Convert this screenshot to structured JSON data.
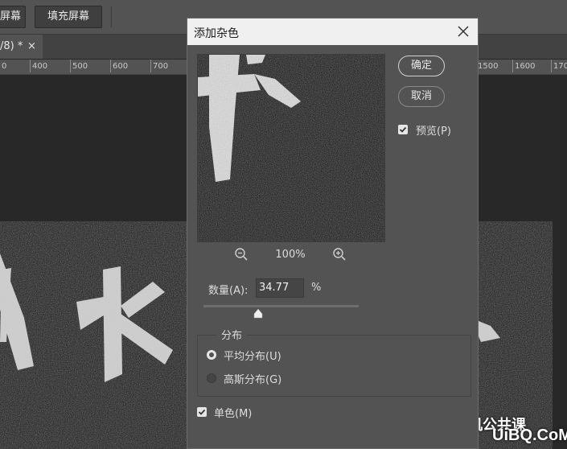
{
  "photoshop": {
    "toolbar": {
      "button_fit_screen_partial": "屏幕",
      "button_fill_screen": "填充屏幕"
    },
    "doc_tab": {
      "title": "/8) *",
      "close": "×"
    },
    "ruler_labels": [
      "0",
      "400",
      "500",
      "600",
      "700",
      "1500",
      "1600",
      "1700"
    ],
    "canvas_text": "人水"
  },
  "dialog": {
    "title": "添加杂色",
    "buttons": {
      "ok": "确定",
      "cancel": "取消"
    },
    "preview": {
      "label": "预览(P)",
      "checked": true,
      "zoom": "100%"
    },
    "amount": {
      "label": "数量(A):",
      "value": "34.77",
      "unit": "%",
      "fraction": 0.35
    },
    "distribution": {
      "legend": "分布",
      "options": [
        {
          "label": "平均分布(U)",
          "selected": true
        },
        {
          "label": "高斯分布(G)",
          "selected": false
        }
      ]
    },
    "monochromatic": {
      "label": "单色(M)",
      "checked": true
    }
  },
  "watermark": {
    "text": "计算机公共课",
    "logo": "UiBQ.CoM"
  },
  "colors": {
    "dialog_bg": "#535353",
    "title_bg": "#f0f0f0",
    "app_bg": "#282828"
  }
}
